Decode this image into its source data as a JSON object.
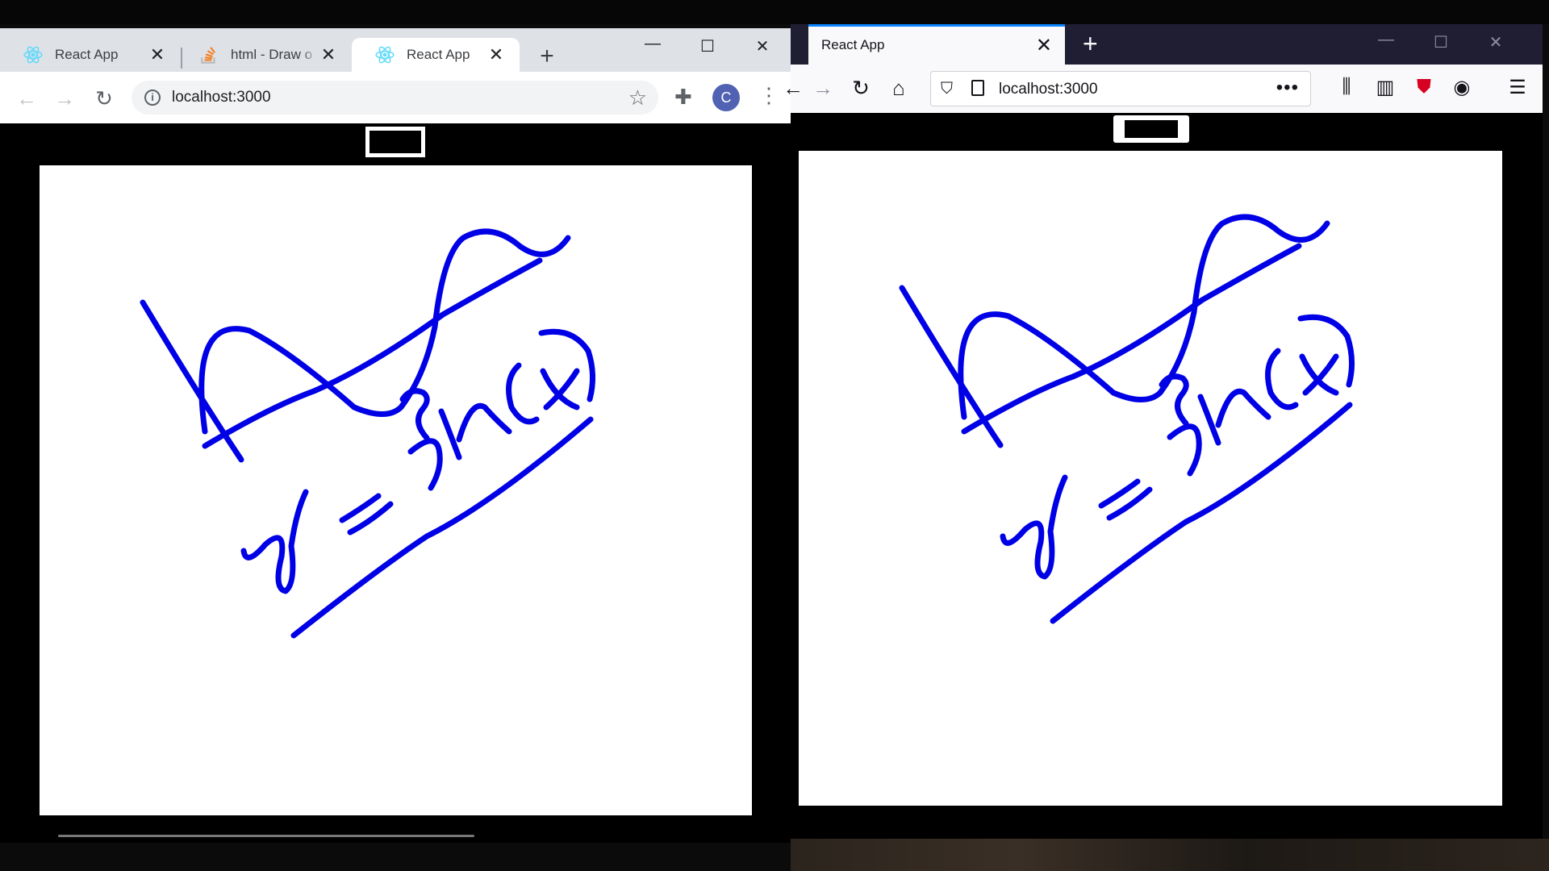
{
  "chrome": {
    "tabs": [
      {
        "title": "React App",
        "icon": "react-icon"
      },
      {
        "title": "html - Draw o",
        "icon": "stackoverflow-icon"
      },
      {
        "title": "React App",
        "icon": "react-icon",
        "active": true
      }
    ],
    "new_tab": "+",
    "address": "localhost:3000",
    "avatar_initial": "C",
    "stroke_color": "#0000e6"
  },
  "firefox": {
    "tab_title": "React App",
    "new_tab": "+",
    "address": "localhost:3000",
    "accent": "#0a84ff"
  }
}
